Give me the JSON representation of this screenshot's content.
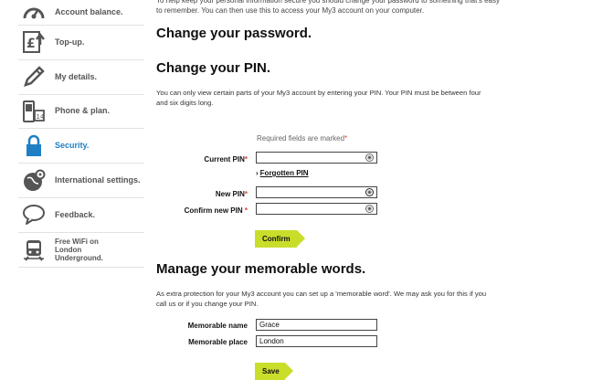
{
  "sidebar": {
    "items": [
      {
        "label": "Account balance.",
        "icon": "speedometer-icon"
      },
      {
        "label": "Top-up.",
        "icon": "pound-upload-icon"
      },
      {
        "label": "My details.",
        "icon": "pencil-icon"
      },
      {
        "label": "Phone & plan.",
        "icon": "phone-calendar-icon"
      },
      {
        "label": "Security.",
        "icon": "padlock-icon"
      },
      {
        "label": "International settings.",
        "icon": "globe-gear-icon"
      },
      {
        "label": "Feedback.",
        "icon": "speech-bubble-icon"
      },
      {
        "label": "Free WiFi on London Underground.",
        "icon": "train-icon"
      }
    ],
    "active_index": 4,
    "active_color": "#1e7fc4"
  },
  "main": {
    "intro_text": "To help keep your personal information secure you should change your password to something that's easy to remember. You can then use this to access your My3 account on your computer.",
    "change_password_title": "Change your password.",
    "change_pin_title": "Change your PIN.",
    "pin_description": "You can only view certain parts of your My3 account by entering your PIN. Your PIN must be between four and six digits long.",
    "required_note": "Required fields are marked",
    "required_star": "*",
    "current_pin_label": "Current PIN",
    "forgotten_pin_link": "Forgotten PIN",
    "new_pin_label": "New PIN",
    "confirm_pin_label": "Confirm new PIN ",
    "confirm_button": "Confirm",
    "memorable_title": "Manage your memorable words.",
    "memorable_description": "As extra protection for your My3 account you can set up a 'memorable word'. We may ask you for this if you call us or if you change your PIN.",
    "memorable_name_label": "Memorable name",
    "memorable_name_value": "Grace",
    "memorable_place_label": "Memorable place",
    "memorable_place_value": "London",
    "save_button": "Save"
  },
  "colors": {
    "button_bg": "#c9dd2b",
    "required_star": "#d42"
  }
}
